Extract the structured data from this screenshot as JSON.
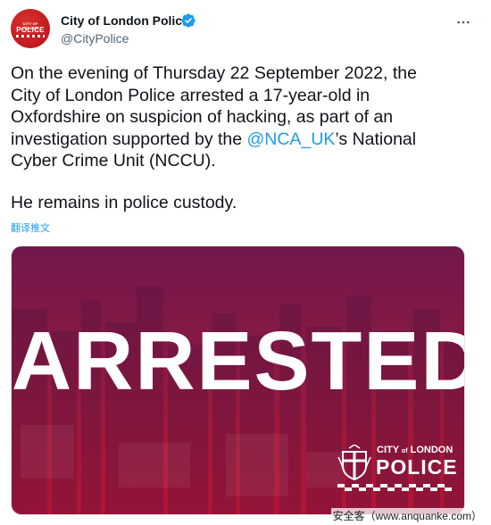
{
  "account": {
    "name": "City of London Police",
    "handle": "@CityPolice",
    "avatar_text_top": "CITY OF LONDON",
    "avatar_text_main": "POLICE"
  },
  "tweet": {
    "line1": "On the evening of Thursday 22 September 2022, the",
    "line2": "City of London Police arrested a 17-year-old in",
    "line3": "Oxfordshire on suspicion of hacking, as part of an",
    "line4_before": "investigation supported by the ",
    "mention": "@NCA_UK",
    "line4_after": "’s National",
    "line5": "Cyber Crime Unit (NCCU).",
    "line6": "He remains in police custody."
  },
  "translate_label": "翻译推文",
  "media": {
    "headline": "ARRESTED",
    "logo_city": "CITY",
    "logo_of": "of",
    "logo_london": "LONDON",
    "logo_police": "POLICE"
  },
  "watermark": "安全客（www.anquanke.com）",
  "colors": {
    "mention": "#1d9bf0",
    "verified": "#1d9bf0",
    "brand_red": "#c01a1f"
  },
  "icons": {
    "verified": "verified-badge-icon",
    "more": "more-options-icon"
  }
}
